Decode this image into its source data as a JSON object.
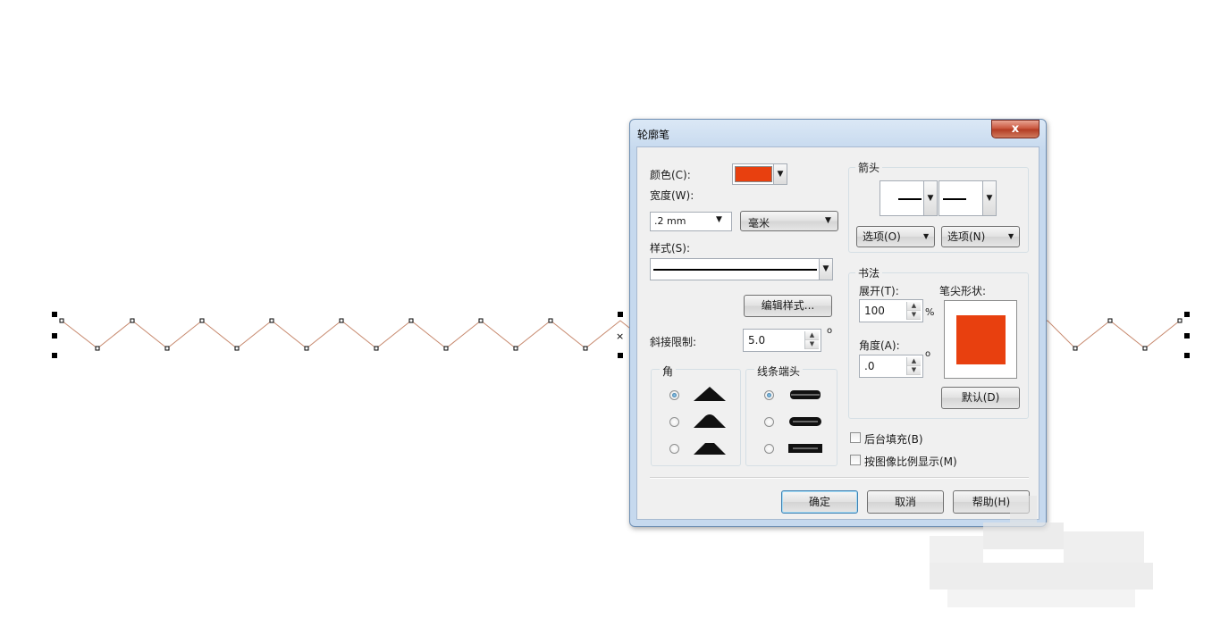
{
  "dialog": {
    "title": "轮廓笔",
    "close_label": "x",
    "color_label": "颜色(C):",
    "color_value": "#e8400f",
    "width_label": "宽度(W):",
    "width_value": ".2 mm",
    "width_unit": "毫米",
    "style_label": "样式(S):",
    "edit_style_label": "编辑样式...",
    "miter_label": "斜接限制:",
    "miter_value": "5.0",
    "degree_symbol": "o",
    "corner_group_label": "角",
    "linecap_group_label": "线条端头",
    "arrow_group_label": "箭头",
    "arrow_options_left": "选项(O)",
    "arrow_options_right": "选项(N)",
    "calligraphy_group_label": "书法",
    "stretch_label": "展开(T):",
    "stretch_value": "100",
    "percent_symbol": "%",
    "nib_shape_label": "笔尖形状:",
    "nib_color": "#e8400f",
    "angle_label": "角度(A):",
    "angle_value": ".0",
    "default_button": "默认(D)",
    "behind_fill_label": "后台填充(B)",
    "scale_with_image_label": "按图像比例显示(M)",
    "ok_button": "确定",
    "cancel_button": "取消",
    "help_button": "帮助(H)",
    "corner_selected": 0,
    "linecap_selected": 0,
    "behind_fill_checked": false,
    "scale_with_image_checked": false
  }
}
